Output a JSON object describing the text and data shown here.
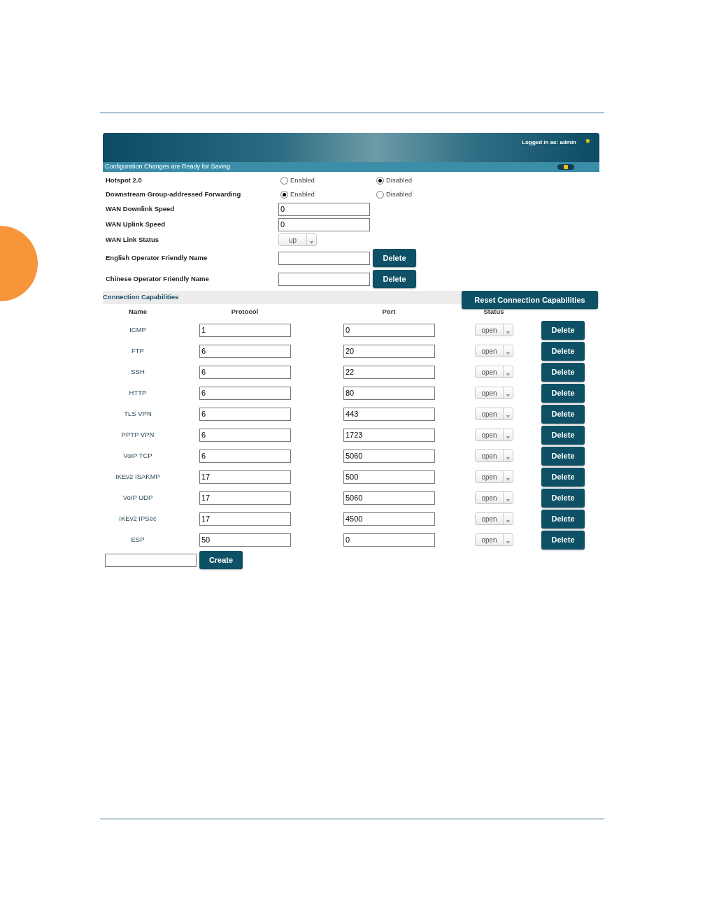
{
  "header": {
    "logged_in": "Logged in as: admin"
  },
  "status_bar": {
    "message": "Configuration Changes are Ready for Saving"
  },
  "settings": [
    {
      "kind": "radio",
      "label": "Hotspot 2.0",
      "options": [
        {
          "label": "Enabled",
          "selected": false
        },
        {
          "label": "Disabled",
          "selected": true
        }
      ]
    },
    {
      "kind": "radio",
      "label": "Downstream Group-addressed Forwarding",
      "options": [
        {
          "label": "Enabled",
          "selected": true
        },
        {
          "label": "Disabled",
          "selected": false
        }
      ]
    },
    {
      "kind": "text",
      "label": "WAN Downlink Speed",
      "value": "0"
    },
    {
      "kind": "text",
      "label": "WAN Uplink Speed",
      "value": "0"
    },
    {
      "kind": "select",
      "label": "WAN Link Status",
      "value": "up"
    },
    {
      "kind": "text_delete",
      "label": "English Operator Friendly Name",
      "button": "Delete"
    },
    {
      "kind": "text_delete",
      "label": "Chinese Operator Friendly Name",
      "button": "Delete"
    }
  ],
  "connection_capabilities": {
    "title": "Connection Capabilities",
    "reset_button": "Reset Connection Capabilities",
    "columns": [
      "Name",
      "Protocol",
      "Port",
      "Status"
    ],
    "rows": [
      {
        "name": "ICMP",
        "protocol": "1",
        "port": "0",
        "status": "open",
        "button": "Delete"
      },
      {
        "name": "FTP",
        "protocol": "6",
        "port": "20",
        "status": "open",
        "button": "Delete"
      },
      {
        "name": "SSH",
        "protocol": "6",
        "port": "22",
        "status": "open",
        "button": "Delete"
      },
      {
        "name": "HTTP",
        "protocol": "6",
        "port": "80",
        "status": "open",
        "button": "Delete"
      },
      {
        "name": "TLS VPN",
        "protocol": "6",
        "port": "443",
        "status": "open",
        "button": "Delete"
      },
      {
        "name": "PPTP VPN",
        "protocol": "6",
        "port": "1723",
        "status": "open",
        "button": "Delete"
      },
      {
        "name": "VoIP TCP",
        "protocol": "6",
        "port": "5060",
        "status": "open",
        "button": "Delete"
      },
      {
        "name": "IKEv2 ISAKMP",
        "protocol": "17",
        "port": "500",
        "status": "open",
        "button": "Delete"
      },
      {
        "name": "VoIP UDP",
        "protocol": "17",
        "port": "5060",
        "status": "open",
        "button": "Delete"
      },
      {
        "name": "IKEv2 IPSec",
        "protocol": "17",
        "port": "4500",
        "status": "open",
        "button": "Delete"
      },
      {
        "name": "ESP",
        "protocol": "50",
        "port": "0",
        "status": "open",
        "button": "Delete"
      }
    ],
    "create_button": "Create"
  }
}
